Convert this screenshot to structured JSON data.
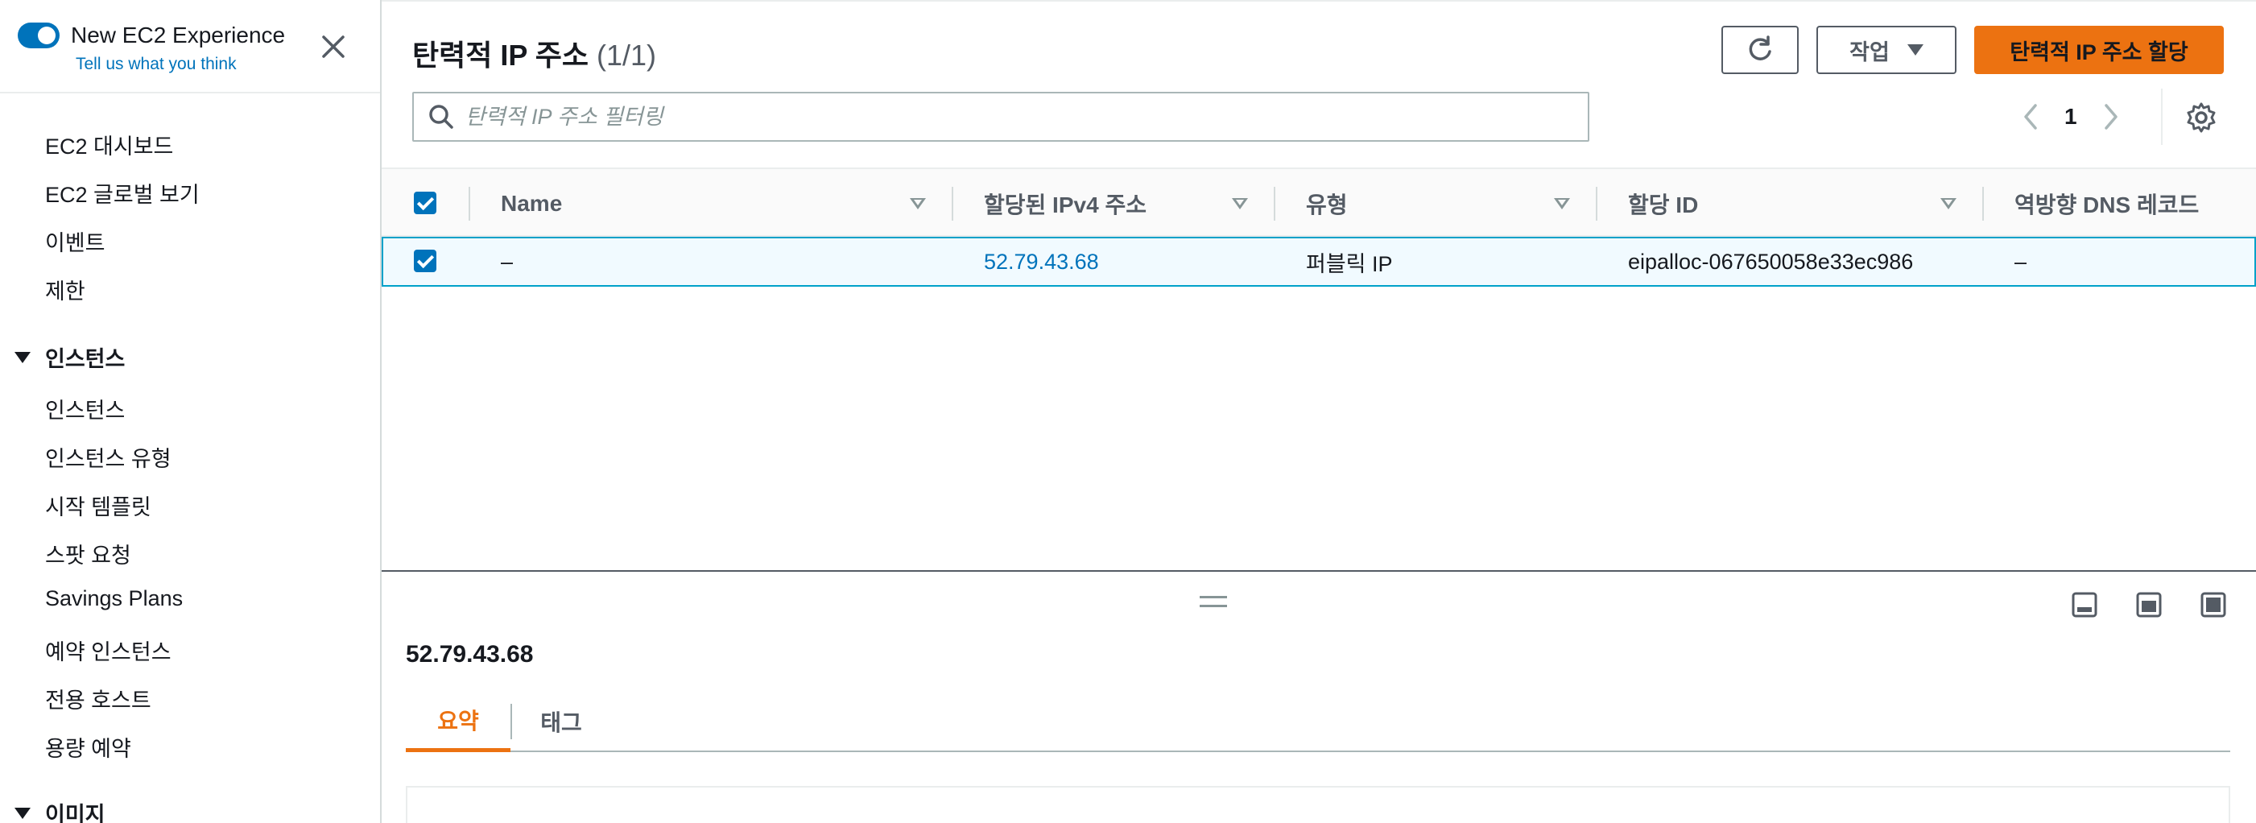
{
  "sidebar": {
    "experience_title": "New EC2 Experience",
    "experience_link": "Tell us what you think",
    "items": [
      {
        "label": "EC2 대시보드"
      },
      {
        "label": "EC2 글로벌 보기"
      },
      {
        "label": "이벤트"
      },
      {
        "label": "제한"
      }
    ],
    "sections": [
      {
        "label": "인스턴스",
        "items": [
          {
            "label": "인스턴스"
          },
          {
            "label": "인스턴스 유형"
          },
          {
            "label": "시작 템플릿"
          },
          {
            "label": "스팟 요청"
          },
          {
            "label": "Savings Plans"
          },
          {
            "label": "예약 인스턴스"
          },
          {
            "label": "전용 호스트"
          },
          {
            "label": "용량 예약"
          }
        ]
      },
      {
        "label": "이미지",
        "items": []
      }
    ]
  },
  "header": {
    "title": "탄력적 IP 주소",
    "count": "(1/1)",
    "actions_label": "작업",
    "allocate_label": "탄력적 IP 주소 할당"
  },
  "search": {
    "placeholder": "탄력적 IP 주소 필터링",
    "value": ""
  },
  "pagination": {
    "page": "1"
  },
  "table": {
    "columns": [
      "Name",
      "할당된 IPv4 주소",
      "유형",
      "할당 ID",
      "역방향 DNS 레코드"
    ],
    "rows": [
      {
        "selected": true,
        "name": "–",
        "ipv4": "52.79.43.68",
        "type": "퍼블릭 IP",
        "allocation_id": "eipalloc-067650058e33ec986",
        "reverse_dns": "–"
      }
    ]
  },
  "detail": {
    "title": "52.79.43.68",
    "tabs": [
      {
        "label": "요약",
        "active": true
      },
      {
        "label": "태그",
        "active": false
      }
    ]
  },
  "colors": {
    "primary": "#ec7211",
    "link": "#0073bb",
    "selected_row": "#f1faff",
    "selected_border": "#00a1c9"
  },
  "icons": {
    "close": "close-icon",
    "refresh": "refresh-icon",
    "search": "search-icon",
    "settings": "gear-icon",
    "prev": "chevron-left-icon",
    "next": "chevron-right-icon"
  }
}
